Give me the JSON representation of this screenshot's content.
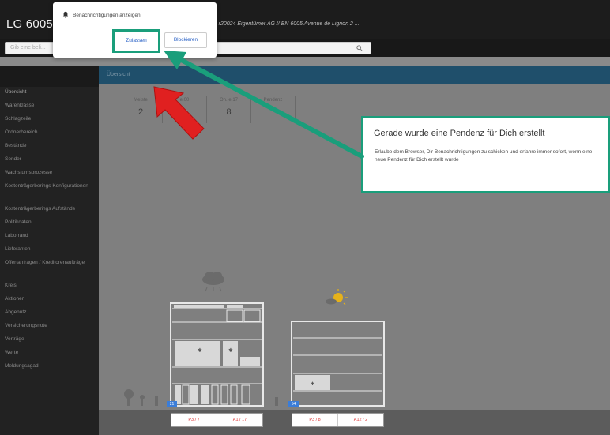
{
  "topbar": {
    "app_title": "LG 6005,",
    "info_text": "E r20024 Eigentümer AG  //  BN 6005 Avenue de Lignon 2 ..."
  },
  "search": {
    "placeholder": "Gib eine beli..."
  },
  "header": {
    "breadcrumb": "Übersicht"
  },
  "sidebar": {
    "items": [
      {
        "label": "Übersicht"
      },
      {
        "label": "Warenklasse"
      },
      {
        "label": "Schlagzeile"
      },
      {
        "label": "Ordnerbereich"
      },
      {
        "label": "Bestände"
      },
      {
        "label": "Sender"
      },
      {
        "label": "Wachstumsprozesse"
      },
      {
        "label": "Kostenträgerberings Konfigurationen"
      },
      {
        "label": "Kostenträgerberings Aufstände"
      },
      {
        "label": "Politikdaten"
      },
      {
        "label": "Laborrand"
      },
      {
        "label": "Lieferanten"
      },
      {
        "label": "Offertanfragen / Kreditorenaufträge"
      },
      {
        "label": "Kreis"
      },
      {
        "label": "Aktionen"
      },
      {
        "label": "Abgenutz"
      },
      {
        "label": "Versicherungsnote"
      },
      {
        "label": "Verträge"
      },
      {
        "label": "Werte"
      },
      {
        "label": "Meldungsagad"
      }
    ]
  },
  "stats": [
    {
      "label": "Meiste",
      "value": "2"
    },
    {
      "label": "e.00",
      "value": ""
    },
    {
      "label": "On. e.17",
      "value": "8"
    },
    {
      "label": "Pendenz",
      "value": ""
    }
  ],
  "notification_popup": {
    "text": "Benachrichtigungen anzeigen",
    "allow_label": "Zulassen",
    "block_label": "Blockieren"
  },
  "callout": {
    "title": "Gerade wurde eine Pendenz für Dich erstellt",
    "body": "Erlaube dem Browser, Dir Benachrichtigungen zu schicken und erfahre immer sofort, wenn eine neue Pendenz für Dich erstellt wurde"
  },
  "shelves": [
    {
      "left_label": "P3 / 7",
      "right_label": "A1 / 17",
      "badge": "21"
    },
    {
      "left_label": "P3 / 8",
      "right_label": "A12 / 2",
      "badge": "54"
    }
  ],
  "colors": {
    "accent": "#1a9e7b",
    "header_blue": "#1f4f6b",
    "arrow_red": "#e02020",
    "link_blue": "#2a62c6"
  }
}
